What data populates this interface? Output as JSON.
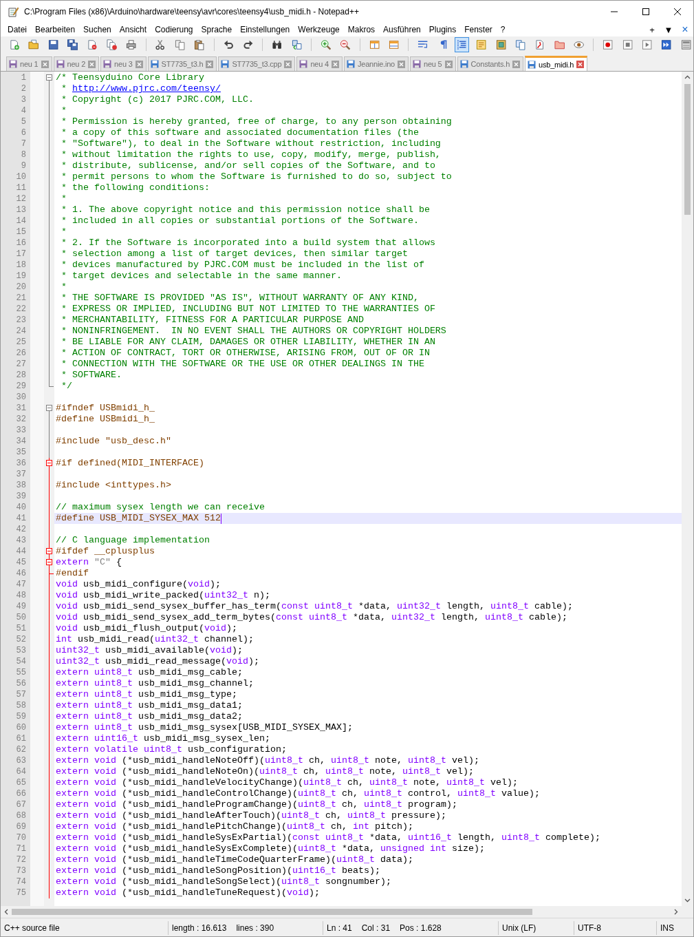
{
  "window": {
    "title": "C:\\Program Files (x86)\\Arduino\\hardware\\teensy\\avr\\cores\\teensy4\\usb_midi.h - Notepad++"
  },
  "menu_bar": {
    "items": [
      "Datei",
      "Bearbeiten",
      "Suchen",
      "Ansicht",
      "Codierung",
      "Sprache",
      "Einstellungen",
      "Werkzeuge",
      "Makros",
      "Ausführen",
      "Plugins",
      "Fenster",
      "?"
    ],
    "controls": [
      "+",
      "▼",
      "×"
    ]
  },
  "toolbar": [
    {
      "pressed": false
    },
    {
      "pressed": false
    },
    {
      "pressed": false
    },
    {
      "pressed": false
    },
    {
      "pressed": false
    },
    {
      "pressed": false
    },
    {
      "pressed": false
    },
    {
      "pressed": false
    },
    {
      "pressed": false
    },
    {
      "pressed": false
    },
    {
      "pressed": false
    },
    {
      "pressed": false
    },
    {
      "pressed": false
    },
    {
      "pressed": false
    },
    {
      "pressed": false
    },
    {
      "pressed": false
    },
    {
      "pressed": false
    },
    {
      "pressed": false
    },
    {
      "pressed": false
    },
    {
      "pressed": false
    },
    {
      "pressed": true
    },
    {
      "pressed": false
    },
    {
      "pressed": false
    },
    {
      "pressed": false
    },
    {
      "pressed": false
    },
    {
      "pressed": false
    },
    {
      "pressed": false
    },
    {
      "pressed": false
    },
    {
      "pressed": false
    },
    {
      "pressed": false
    },
    {
      "pressed": false
    },
    {
      "pressed": false
    }
  ],
  "tabs": [
    {
      "label": "neu 1",
      "selected": false,
      "unsaved": true
    },
    {
      "label": "neu 2",
      "selected": false,
      "unsaved": true
    },
    {
      "label": "neu 3",
      "selected": false,
      "unsaved": true
    },
    {
      "label": "ST7735_t3.h",
      "selected": false,
      "unsaved": false
    },
    {
      "label": "ST7735_t3.cpp",
      "selected": false,
      "unsaved": false
    },
    {
      "label": "neu 4",
      "selected": false,
      "unsaved": true
    },
    {
      "label": "Jeannie.ino",
      "selected": false,
      "unsaved": false
    },
    {
      "label": "neu 5",
      "selected": false,
      "unsaved": true
    },
    {
      "label": "Constants.h",
      "selected": false,
      "unsaved": false
    },
    {
      "label": "usb_midi.h",
      "selected": true,
      "unsaved": false
    }
  ],
  "editor": {
    "lines": [
      {
        "number": "1",
        "kind": "fold-open",
        "highlighted": false,
        "current": false,
        "parts": [
          {
            "kind": "comment",
            "text": "/* Teensyduino Core Library"
          }
        ]
      },
      {
        "number": "2",
        "kind": "fold-body",
        "highlighted": false,
        "current": false,
        "parts": [
          {
            "kind": "comment",
            "text": " * "
          },
          {
            "kind": "link",
            "text": "http://www.pjrc.com/teensy/"
          }
        ]
      },
      {
        "number": "3",
        "kind": "fold-body",
        "highlighted": false,
        "current": false,
        "parts": [
          {
            "kind": "comment",
            "text": " * Copyright (c) 2017 PJRC.COM, LLC."
          }
        ]
      },
      {
        "number": "4",
        "kind": "fold-body",
        "highlighted": false,
        "current": false,
        "parts": [
          {
            "kind": "comment",
            "text": " *"
          }
        ]
      },
      {
        "number": "5",
        "kind": "fold-body",
        "highlighted": false,
        "current": false,
        "parts": [
          {
            "kind": "comment",
            "text": " * Permission is hereby granted, free of charge, to any person obtaining"
          }
        ]
      },
      {
        "number": "6",
        "kind": "fold-body",
        "highlighted": false,
        "current": false,
        "parts": [
          {
            "kind": "comment",
            "text": " * a copy of this software and associated documentation files (the"
          }
        ]
      },
      {
        "number": "7",
        "kind": "fold-body",
        "highlighted": false,
        "current": false,
        "parts": [
          {
            "kind": "comment",
            "text": " * \"Software\"), to deal in the Software without restriction, including"
          }
        ]
      },
      {
        "number": "8",
        "kind": "fold-body",
        "highlighted": false,
        "current": false,
        "parts": [
          {
            "kind": "comment",
            "text": " * without limitation the rights to use, copy, modify, merge, publish,"
          }
        ]
      },
      {
        "number": "9",
        "kind": "fold-body",
        "highlighted": false,
        "current": false,
        "parts": [
          {
            "kind": "comment",
            "text": " * distribute, sublicense, and/or sell copies of the Software, and to"
          }
        ]
      },
      {
        "number": "10",
        "kind": "fold-body",
        "highlighted": false,
        "current": false,
        "parts": [
          {
            "kind": "comment",
            "text": " * permit persons to whom the Software is furnished to do so, subject to"
          }
        ]
      },
      {
        "number": "11",
        "kind": "fold-body",
        "highlighted": false,
        "current": false,
        "parts": [
          {
            "kind": "comment",
            "text": " * the following conditions:"
          }
        ]
      },
      {
        "number": "12",
        "kind": "fold-body",
        "highlighted": false,
        "current": false,
        "parts": [
          {
            "kind": "comment",
            "text": " *"
          }
        ]
      },
      {
        "number": "13",
        "kind": "fold-body",
        "highlighted": false,
        "current": false,
        "parts": [
          {
            "kind": "comment",
            "text": " * 1. The above copyright notice and this permission notice shall be"
          }
        ]
      },
      {
        "number": "14",
        "kind": "fold-body",
        "highlighted": false,
        "current": false,
        "parts": [
          {
            "kind": "comment",
            "text": " * included in all copies or substantial portions of the Software."
          }
        ]
      },
      {
        "number": "15",
        "kind": "fold-body",
        "highlighted": false,
        "current": false,
        "parts": [
          {
            "kind": "comment",
            "text": " *"
          }
        ]
      },
      {
        "number": "16",
        "kind": "fold-body",
        "highlighted": false,
        "current": false,
        "parts": [
          {
            "kind": "comment",
            "text": " * 2. If the Software is incorporated into a build system that allows"
          }
        ]
      },
      {
        "number": "17",
        "kind": "fold-body",
        "highlighted": false,
        "current": false,
        "parts": [
          {
            "kind": "comment",
            "text": " * selection among a list of target devices, then similar target"
          }
        ]
      },
      {
        "number": "18",
        "kind": "fold-body",
        "highlighted": false,
        "current": false,
        "parts": [
          {
            "kind": "comment",
            "text": " * devices manufactured by PJRC.COM must be included in the list of"
          }
        ]
      },
      {
        "number": "19",
        "kind": "fold-body",
        "highlighted": false,
        "current": false,
        "parts": [
          {
            "kind": "comment",
            "text": " * target devices and selectable in the same manner."
          }
        ]
      },
      {
        "number": "20",
        "kind": "fold-body",
        "highlighted": false,
        "current": false,
        "parts": [
          {
            "kind": "comment",
            "text": " *"
          }
        ]
      },
      {
        "number": "21",
        "kind": "fold-body",
        "highlighted": false,
        "current": false,
        "parts": [
          {
            "kind": "comment",
            "text": " * THE SOFTWARE IS PROVIDED \"AS IS\", WITHOUT WARRANTY OF ANY KIND,"
          }
        ]
      },
      {
        "number": "22",
        "kind": "fold-body",
        "highlighted": false,
        "current": false,
        "parts": [
          {
            "kind": "comment",
            "text": " * EXPRESS OR IMPLIED, INCLUDING BUT NOT LIMITED TO THE WARRANTIES OF"
          }
        ]
      },
      {
        "number": "23",
        "kind": "fold-body",
        "highlighted": false,
        "current": false,
        "parts": [
          {
            "kind": "comment",
            "text": " * MERCHANTABILITY, FITNESS FOR A PARTICULAR PURPOSE AND"
          }
        ]
      },
      {
        "number": "24",
        "kind": "fold-body",
        "highlighted": false,
        "current": false,
        "parts": [
          {
            "kind": "comment",
            "text": " * NONINFRINGEMENT.  IN NO EVENT SHALL THE AUTHORS OR COPYRIGHT HOLDERS"
          }
        ]
      },
      {
        "number": "25",
        "kind": "fold-body",
        "highlighted": false,
        "current": false,
        "parts": [
          {
            "kind": "comment",
            "text": " * BE LIABLE FOR ANY CLAIM, DAMAGES OR OTHER LIABILITY, WHETHER IN AN"
          }
        ]
      },
      {
        "number": "26",
        "kind": "fold-body",
        "highlighted": false,
        "current": false,
        "parts": [
          {
            "kind": "comment",
            "text": " * ACTION OF CONTRACT, TORT OR OTHERWISE, ARISING FROM, OUT OF OR IN"
          }
        ]
      },
      {
        "number": "27",
        "kind": "fold-body",
        "highlighted": false,
        "current": false,
        "parts": [
          {
            "kind": "comment",
            "text": " * CONNECTION WITH THE SOFTWARE OR THE USE OR OTHER DEALINGS IN THE"
          }
        ]
      },
      {
        "number": "28",
        "kind": "fold-body",
        "highlighted": false,
        "current": false,
        "parts": [
          {
            "kind": "comment",
            "text": " * SOFTWARE."
          }
        ]
      },
      {
        "number": "29",
        "kind": "fold-end",
        "highlighted": false,
        "current": false,
        "parts": [
          {
            "kind": "comment",
            "text": " */"
          }
        ]
      },
      {
        "number": "30",
        "kind": "plain",
        "current": false
      },
      {
        "number": "31",
        "kind": "fold-open",
        "highlighted": false,
        "current": false,
        "parts": [
          {
            "kind": "preprocessor",
            "text": "#ifndef USBmidi_h_"
          }
        ]
      },
      {
        "number": "32",
        "kind": "fold-body",
        "highlighted": false,
        "current": false,
        "parts": [
          {
            "kind": "preprocessor",
            "text": "#define USBmidi_h_"
          }
        ]
      },
      {
        "number": "33",
        "kind": "fold-body",
        "highlighted": false,
        "current": false
      },
      {
        "number": "34",
        "kind": "fold-body",
        "highlighted": false,
        "current": false,
        "parts": [
          {
            "kind": "preprocessor",
            "text": "#include \"usb_desc.h\""
          }
        ]
      },
      {
        "number": "35",
        "kind": "fold-body",
        "highlighted": false,
        "current": false
      },
      {
        "number": "36",
        "kind": "fold-open",
        "highlighted": true,
        "current": false,
        "parts": [
          {
            "kind": "preprocessor",
            "text": "#if defined(MIDI_INTERFACE)"
          }
        ]
      },
      {
        "number": "37",
        "kind": "fold-body",
        "highlighted": true,
        "current": false
      },
      {
        "number": "38",
        "kind": "fold-body",
        "highlighted": true,
        "current": false,
        "parts": [
          {
            "kind": "preprocessor",
            "text": "#include <inttypes.h>"
          }
        ]
      },
      {
        "number": "39",
        "kind": "fold-body",
        "highlighted": true,
        "current": false
      },
      {
        "number": "40",
        "kind": "fold-body",
        "highlighted": true,
        "current": false,
        "parts": [
          {
            "kind": "comment",
            "text": "// maximum sysex length we can receive"
          }
        ]
      },
      {
        "number": "41",
        "kind": "fold-body",
        "highlighted": true,
        "current": true,
        "parts": [
          {
            "kind": "preprocessor",
            "text": "#define USB_MIDI_SYSEX_MAX 512"
          }
        ]
      },
      {
        "number": "42",
        "kind": "fold-body",
        "highlighted": true,
        "current": false
      },
      {
        "number": "43",
        "kind": "fold-body",
        "highlighted": true,
        "current": false,
        "parts": [
          {
            "kind": "comment",
            "text": "// C language implementation"
          }
        ]
      },
      {
        "number": "44",
        "kind": "fold-open",
        "highlighted": true,
        "current": false,
        "parts": [
          {
            "kind": "preprocessor",
            "text": "#ifdef __cplusplus"
          }
        ]
      },
      {
        "number": "45",
        "kind": "fold-open",
        "highlighted": true,
        "current": false,
        "parts": [
          {
            "kind": "keyword",
            "text": "extern"
          },
          {
            "kind": "string",
            "text": " \"C\""
          },
          {
            "kind": "text",
            "text": " {"
          }
        ]
      },
      {
        "number": "46",
        "kind": "fold-end",
        "highlighted": true,
        "current": false,
        "parts": [
          {
            "kind": "preprocessor",
            "text": "#endif"
          }
        ]
      },
      {
        "number": "47",
        "kind": "fold-body",
        "highlighted": true,
        "current": false,
        "parts": [
          {
            "kind": "keyword",
            "text": "void"
          },
          {
            "kind": "text",
            "text": " usb_midi_configure("
          },
          {
            "kind": "keyword",
            "text": "void"
          },
          {
            "kind": "text",
            "text": ");"
          }
        ]
      },
      {
        "number": "48",
        "kind": "fold-body",
        "highlighted": true,
        "current": false,
        "parts": [
          {
            "kind": "keyword",
            "text": "void"
          },
          {
            "kind": "text",
            "text": " usb_midi_write_packed("
          },
          {
            "kind": "keyword",
            "text": "uint32_t"
          },
          {
            "kind": "text",
            "text": " n);"
          }
        ]
      },
      {
        "number": "49",
        "kind": "fold-body",
        "highlighted": true,
        "current": false,
        "parts": [
          {
            "kind": "keyword",
            "text": "void"
          },
          {
            "kind": "text",
            "text": " usb_midi_send_sysex_buffer_has_term("
          },
          {
            "kind": "keyword",
            "text": "const uint8_t"
          },
          {
            "kind": "text",
            "text": " *data, "
          },
          {
            "kind": "keyword",
            "text": "uint32_t"
          },
          {
            "kind": "text",
            "text": " length, "
          },
          {
            "kind": "keyword",
            "text": "uint8_t"
          },
          {
            "kind": "text",
            "text": " cable);"
          }
        ]
      },
      {
        "number": "50",
        "kind": "fold-body",
        "highlighted": true,
        "current": false,
        "parts": [
          {
            "kind": "keyword",
            "text": "void"
          },
          {
            "kind": "text",
            "text": " usb_midi_send_sysex_add_term_bytes("
          },
          {
            "kind": "keyword",
            "text": "const uint8_t"
          },
          {
            "kind": "text",
            "text": " *data, "
          },
          {
            "kind": "keyword",
            "text": "uint32_t"
          },
          {
            "kind": "text",
            "text": " length, "
          },
          {
            "kind": "keyword",
            "text": "uint8_t"
          },
          {
            "kind": "text",
            "text": " cable);"
          }
        ]
      },
      {
        "number": "51",
        "kind": "fold-body",
        "highlighted": true,
        "current": false,
        "parts": [
          {
            "kind": "keyword",
            "text": "void"
          },
          {
            "kind": "text",
            "text": " usb_midi_flush_output("
          },
          {
            "kind": "keyword",
            "text": "void"
          },
          {
            "kind": "text",
            "text": ");"
          }
        ]
      },
      {
        "number": "52",
        "kind": "fold-body",
        "highlighted": true,
        "current": false,
        "parts": [
          {
            "kind": "keyword",
            "text": "int"
          },
          {
            "kind": "text",
            "text": " usb_midi_read("
          },
          {
            "kind": "keyword",
            "text": "uint32_t"
          },
          {
            "kind": "text",
            "text": " channel);"
          }
        ]
      },
      {
        "number": "53",
        "kind": "fold-body",
        "highlighted": true,
        "current": false,
        "parts": [
          {
            "kind": "keyword",
            "text": "uint32_t"
          },
          {
            "kind": "text",
            "text": " usb_midi_available("
          },
          {
            "kind": "keyword",
            "text": "void"
          },
          {
            "kind": "text",
            "text": ");"
          }
        ]
      },
      {
        "number": "54",
        "kind": "fold-body",
        "highlighted": true,
        "current": false,
        "parts": [
          {
            "kind": "keyword",
            "text": "uint32_t"
          },
          {
            "kind": "text",
            "text": " usb_midi_read_message("
          },
          {
            "kind": "keyword",
            "text": "void"
          },
          {
            "kind": "text",
            "text": ");"
          }
        ]
      },
      {
        "number": "55",
        "kind": "fold-body",
        "highlighted": true,
        "current": false,
        "parts": [
          {
            "kind": "keyword",
            "text": "extern uint8_t"
          },
          {
            "kind": "text",
            "text": " usb_midi_msg_cable;"
          }
        ]
      },
      {
        "number": "56",
        "kind": "fold-body",
        "highlighted": true,
        "current": false,
        "parts": [
          {
            "kind": "keyword",
            "text": "extern uint8_t"
          },
          {
            "kind": "text",
            "text": " usb_midi_msg_channel;"
          }
        ]
      },
      {
        "number": "57",
        "kind": "fold-body",
        "highlighted": true,
        "current": false,
        "parts": [
          {
            "kind": "keyword",
            "text": "extern uint8_t"
          },
          {
            "kind": "text",
            "text": " usb_midi_msg_type;"
          }
        ]
      },
      {
        "number": "58",
        "kind": "fold-body",
        "highlighted": true,
        "current": false,
        "parts": [
          {
            "kind": "keyword",
            "text": "extern uint8_t"
          },
          {
            "kind": "text",
            "text": " usb_midi_msg_data1;"
          }
        ]
      },
      {
        "number": "59",
        "kind": "fold-body",
        "highlighted": true,
        "current": false,
        "parts": [
          {
            "kind": "keyword",
            "text": "extern uint8_t"
          },
          {
            "kind": "text",
            "text": " usb_midi_msg_data2;"
          }
        ]
      },
      {
        "number": "60",
        "kind": "fold-body",
        "highlighted": true,
        "current": false,
        "parts": [
          {
            "kind": "keyword",
            "text": "extern uint8_t"
          },
          {
            "kind": "text",
            "text": " usb_midi_msg_sysex[USB_MIDI_SYSEX_MAX];"
          }
        ]
      },
      {
        "number": "61",
        "kind": "fold-body",
        "highlighted": true,
        "current": false,
        "parts": [
          {
            "kind": "keyword",
            "text": "extern uint16_t"
          },
          {
            "kind": "text",
            "text": " usb_midi_msg_sysex_len;"
          }
        ]
      },
      {
        "number": "62",
        "kind": "fold-body",
        "highlighted": true,
        "current": false,
        "parts": [
          {
            "kind": "keyword",
            "text": "extern volatile uint8_t"
          },
          {
            "kind": "text",
            "text": " usb_configuration;"
          }
        ]
      },
      {
        "number": "63",
        "kind": "fold-body",
        "highlighted": true,
        "current": false,
        "parts": [
          {
            "kind": "keyword",
            "text": "extern void"
          },
          {
            "kind": "text",
            "text": " (*usb_midi_handleNoteOff)("
          },
          {
            "kind": "keyword",
            "text": "uint8_t"
          },
          {
            "kind": "text",
            "text": " ch, "
          },
          {
            "kind": "keyword",
            "text": "uint8_t"
          },
          {
            "kind": "text",
            "text": " note, "
          },
          {
            "kind": "keyword",
            "text": "uint8_t"
          },
          {
            "kind": "text",
            "text": " vel);"
          }
        ]
      },
      {
        "number": "64",
        "kind": "fold-body",
        "highlighted": true,
        "current": false,
        "parts": [
          {
            "kind": "keyword",
            "text": "extern void"
          },
          {
            "kind": "text",
            "text": " (*usb_midi_handleNoteOn)("
          },
          {
            "kind": "keyword",
            "text": "uint8_t"
          },
          {
            "kind": "text",
            "text": " ch, "
          },
          {
            "kind": "keyword",
            "text": "uint8_t"
          },
          {
            "kind": "text",
            "text": " note, "
          },
          {
            "kind": "keyword",
            "text": "uint8_t"
          },
          {
            "kind": "text",
            "text": " vel);"
          }
        ]
      },
      {
        "number": "65",
        "kind": "fold-body",
        "highlighted": true,
        "current": false,
        "parts": [
          {
            "kind": "keyword",
            "text": "extern void"
          },
          {
            "kind": "text",
            "text": " (*usb_midi_handleVelocityChange)("
          },
          {
            "kind": "keyword",
            "text": "uint8_t"
          },
          {
            "kind": "text",
            "text": " ch, "
          },
          {
            "kind": "keyword",
            "text": "uint8_t"
          },
          {
            "kind": "text",
            "text": " note, "
          },
          {
            "kind": "keyword",
            "text": "uint8_t"
          },
          {
            "kind": "text",
            "text": " vel);"
          }
        ]
      },
      {
        "number": "66",
        "kind": "fold-body",
        "highlighted": true,
        "current": false,
        "parts": [
          {
            "kind": "keyword",
            "text": "extern void"
          },
          {
            "kind": "text",
            "text": " (*usb_midi_handleControlChange)("
          },
          {
            "kind": "keyword",
            "text": "uint8_t"
          },
          {
            "kind": "text",
            "text": " ch, "
          },
          {
            "kind": "keyword",
            "text": "uint8_t"
          },
          {
            "kind": "text",
            "text": " control, "
          },
          {
            "kind": "keyword",
            "text": "uint8_t"
          },
          {
            "kind": "text",
            "text": " value);"
          }
        ]
      },
      {
        "number": "67",
        "kind": "fold-body",
        "highlighted": true,
        "current": false,
        "parts": [
          {
            "kind": "keyword",
            "text": "extern void"
          },
          {
            "kind": "text",
            "text": " (*usb_midi_handleProgramChange)("
          },
          {
            "kind": "keyword",
            "text": "uint8_t"
          },
          {
            "kind": "text",
            "text": " ch, "
          },
          {
            "kind": "keyword",
            "text": "uint8_t"
          },
          {
            "kind": "text",
            "text": " program);"
          }
        ]
      },
      {
        "number": "68",
        "kind": "fold-body",
        "highlighted": true,
        "current": false,
        "parts": [
          {
            "kind": "keyword",
            "text": "extern void"
          },
          {
            "kind": "text",
            "text": " (*usb_midi_handleAfterTouch)("
          },
          {
            "kind": "keyword",
            "text": "uint8_t"
          },
          {
            "kind": "text",
            "text": " ch, "
          },
          {
            "kind": "keyword",
            "text": "uint8_t"
          },
          {
            "kind": "text",
            "text": " pressure);"
          }
        ]
      },
      {
        "number": "69",
        "kind": "fold-body",
        "highlighted": true,
        "current": false,
        "parts": [
          {
            "kind": "keyword",
            "text": "extern void"
          },
          {
            "kind": "text",
            "text": " (*usb_midi_handlePitchChange)("
          },
          {
            "kind": "keyword",
            "text": "uint8_t"
          },
          {
            "kind": "text",
            "text": " ch, "
          },
          {
            "kind": "keyword",
            "text": "int"
          },
          {
            "kind": "text",
            "text": " pitch);"
          }
        ]
      },
      {
        "number": "70",
        "kind": "fold-body",
        "highlighted": true,
        "current": false,
        "parts": [
          {
            "kind": "keyword",
            "text": "extern void"
          },
          {
            "kind": "text",
            "text": " (*usb_midi_handleSysExPartial)("
          },
          {
            "kind": "keyword",
            "text": "const uint8_t"
          },
          {
            "kind": "text",
            "text": " *data, "
          },
          {
            "kind": "keyword",
            "text": "uint16_t"
          },
          {
            "kind": "text",
            "text": " length, "
          },
          {
            "kind": "keyword",
            "text": "uint8_t"
          },
          {
            "kind": "text",
            "text": " complete);"
          }
        ]
      },
      {
        "number": "71",
        "kind": "fold-body",
        "highlighted": true,
        "current": false,
        "parts": [
          {
            "kind": "keyword",
            "text": "extern void"
          },
          {
            "kind": "text",
            "text": " (*usb_midi_handleSysExComplete)("
          },
          {
            "kind": "keyword",
            "text": "uint8_t"
          },
          {
            "kind": "text",
            "text": " *data, "
          },
          {
            "kind": "keyword",
            "text": "unsigned int"
          },
          {
            "kind": "text",
            "text": " size);"
          }
        ]
      },
      {
        "number": "72",
        "kind": "fold-body",
        "highlighted": true,
        "current": false,
        "parts": [
          {
            "kind": "keyword",
            "text": "extern void"
          },
          {
            "kind": "text",
            "text": " (*usb_midi_handleTimeCodeQuarterFrame)("
          },
          {
            "kind": "keyword",
            "text": "uint8_t"
          },
          {
            "kind": "text",
            "text": " data);"
          }
        ]
      },
      {
        "number": "73",
        "kind": "fold-body",
        "highlighted": true,
        "current": false,
        "parts": [
          {
            "kind": "keyword",
            "text": "extern void"
          },
          {
            "kind": "text",
            "text": " (*usb_midi_handleSongPosition)("
          },
          {
            "kind": "keyword",
            "text": "uint16_t"
          },
          {
            "kind": "text",
            "text": " beats);"
          }
        ]
      },
      {
        "number": "74",
        "kind": "fold-body",
        "highlighted": true,
        "current": false,
        "parts": [
          {
            "kind": "keyword",
            "text": "extern void"
          },
          {
            "kind": "text",
            "text": " (*usb_midi_handleSongSelect)("
          },
          {
            "kind": "keyword",
            "text": "uint8_t"
          },
          {
            "kind": "text",
            "text": " songnumber);"
          }
        ]
      },
      {
        "number": "75",
        "kind": "fold-body",
        "highlighted": true,
        "current": false,
        "parts": [
          {
            "kind": "keyword",
            "text": "extern void"
          },
          {
            "kind": "text",
            "text": " (*usb_midi_handleTuneRequest)("
          },
          {
            "kind": "keyword",
            "text": "void"
          },
          {
            "kind": "text",
            "text": ");"
          }
        ]
      }
    ]
  },
  "status_bar": [
    {
      "texts": [
        "C++ source file"
      ]
    },
    {
      "texts": [
        "length : 16.613",
        "lines : 390"
      ]
    },
    {
      "texts": [
        "Ln : 41",
        "Col : 31",
        "Pos : 1.628"
      ]
    },
    {
      "texts": [
        "Unix (LF)"
      ]
    },
    {
      "texts": [
        "UTF-8"
      ]
    },
    {
      "texts": [
        "INS"
      ]
    }
  ]
}
